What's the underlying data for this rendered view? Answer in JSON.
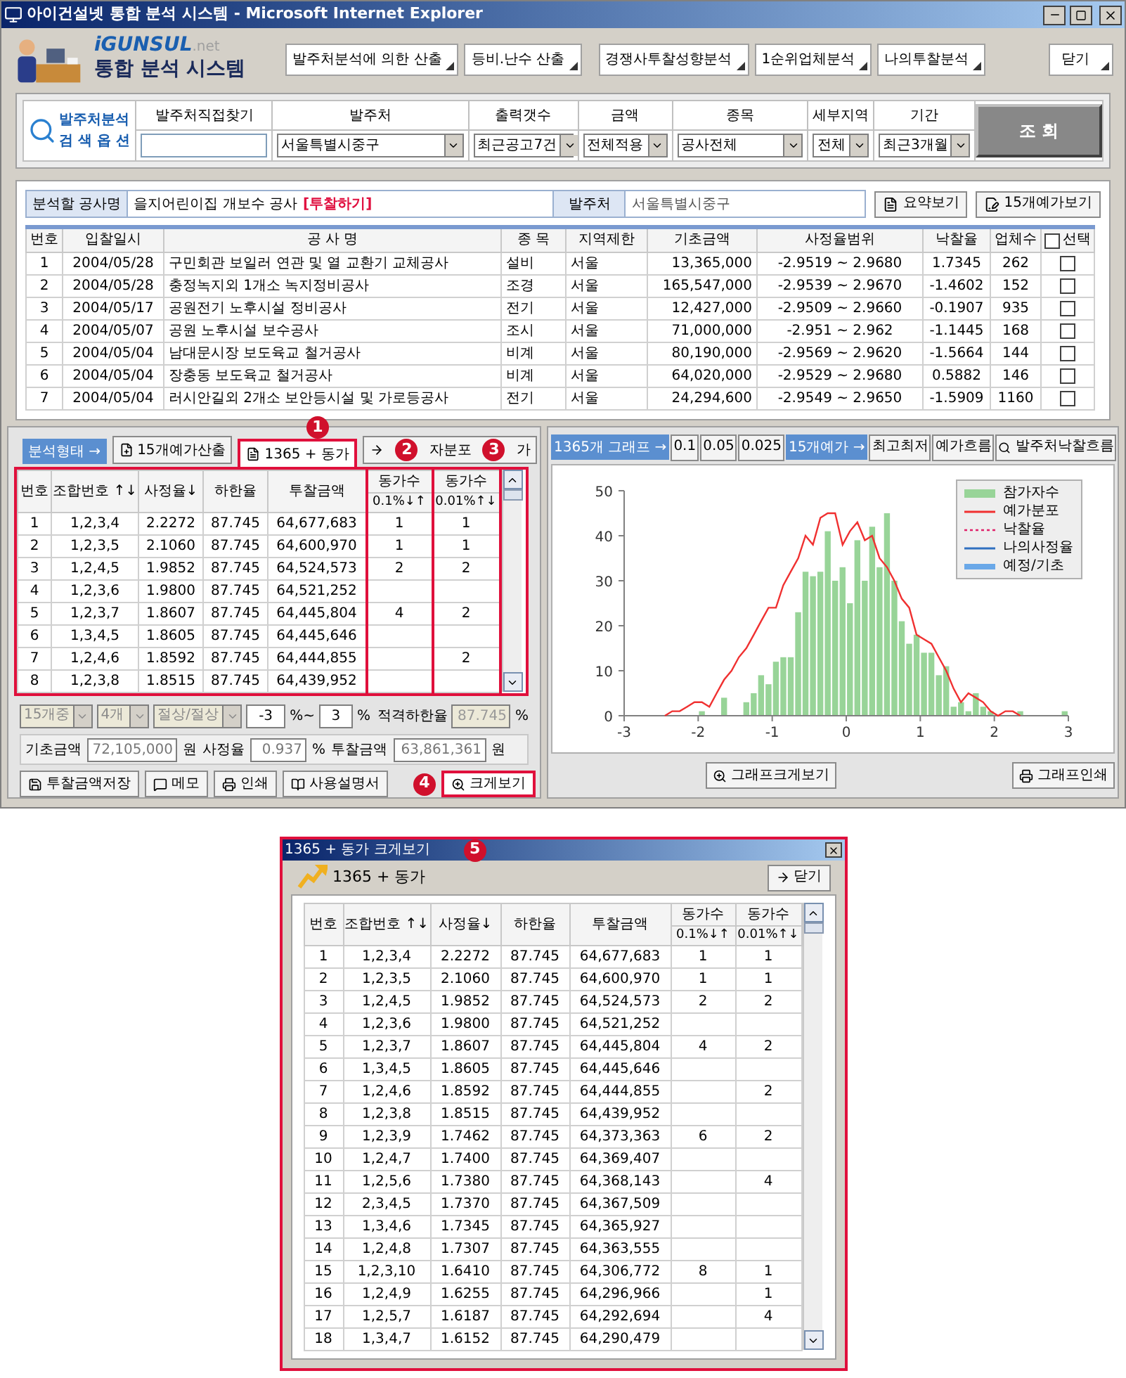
{
  "window": {
    "title": "아이건설넷 통합 분석 시스템 - Microsoft Internet Explorer"
  },
  "header": {
    "brand": "iGUNSUL",
    "brand_suffix": ".net",
    "title": "통합 분석 시스템",
    "nav_buttons": [
      "발주처분석에 의한 산출",
      "등비.난수 산출",
      "경쟁사투찰성향분석",
      "1순위업체분석",
      "나의투찰분석"
    ],
    "close_button": "닫기"
  },
  "search_options": {
    "title": "발주처분석",
    "subtitle": "검 색 옵 션",
    "fields": [
      {
        "label": "발주처직접찾기",
        "kind": "input"
      },
      {
        "label": "발주처",
        "kind": "select",
        "value": "서울특별시중구"
      },
      {
        "label": "출력갯수",
        "kind": "select",
        "value": "최근공고7건"
      },
      {
        "label": "금액",
        "kind": "select",
        "value": "전체적용"
      },
      {
        "label": "종목",
        "kind": "select",
        "value": "공사전체"
      },
      {
        "label": "세부지역",
        "kind": "select",
        "value": "전체"
      },
      {
        "label": "기간",
        "kind": "select",
        "value": "최근3개월"
      }
    ],
    "search_button": "조 회"
  },
  "project": {
    "label": "분석할 공사명",
    "name": "을지어린이집 개보수 공사",
    "link": "[투찰하기]",
    "owner_label": "발주처",
    "owner": "서울특별시중구",
    "buttons": [
      "요약보기",
      "15개예가보기"
    ]
  },
  "bids": {
    "columns": [
      "번호",
      "입찰일시",
      "공 사 명",
      "종 목",
      "지역제한",
      "기초금액",
      "사정율범위",
      "낙찰율",
      "업체수"
    ],
    "select_all": {
      "label": "선택",
      "checked": false
    },
    "rows": [
      {
        "cells": [
          "1",
          "2004/05/28",
          "구민회관 보일러 연관 및 열 교환기 교체공사",
          "설비",
          "서울",
          "13,365,000",
          "-2.9519 ~ 2.9680",
          "1.7345",
          "262"
        ],
        "checked": false
      },
      {
        "cells": [
          "2",
          "2004/05/28",
          "충정녹지외 1개소 녹지정비공사",
          "조경",
          "서울",
          "165,547,000",
          "-2.9539 ~ 2.9670",
          "-1.4602",
          "152"
        ],
        "checked": false
      },
      {
        "cells": [
          "3",
          "2004/05/17",
          "공원전기 노후시설 정비공사",
          "전기",
          "서울",
          "12,427,000",
          "-2.9509 ~ 2.9660",
          "-0.1907",
          "935"
        ],
        "checked": false
      },
      {
        "cells": [
          "4",
          "2004/05/07",
          "공원 노후시설 보수공사",
          "조시",
          "서울",
          "71,000,000",
          "-2.951 ~ 2.962",
          "-1.1445",
          "168"
        ],
        "checked": false
      },
      {
        "cells": [
          "5",
          "2004/05/04",
          "남대문시장 보도육교 철거공사",
          "비계",
          "서울",
          "80,190,000",
          "-2.9569 ~ 2.9620",
          "-1.5664",
          "144"
        ],
        "checked": false
      },
      {
        "cells": [
          "6",
          "2004/05/04",
          "장충동 보도육교 철거공사",
          "비계",
          "서울",
          "64,020,000",
          "-2.9529 ~ 2.9680",
          "0.5882",
          "146"
        ],
        "checked": false
      },
      {
        "cells": [
          "7",
          "2004/05/04",
          "러시안길외 2개소 보안등시설 및 가로등공사",
          "전기",
          "서울",
          "24,294,600",
          "-2.9549 ~ 2.9650",
          "-1.5909",
          "1160"
        ],
        "checked": false
      }
    ]
  },
  "analysis": {
    "label": "분석형태 →",
    "tabs": [
      {
        "parts": [
          "15개예가산출"
        ],
        "selected": false
      },
      {
        "parts": [
          "1365 + 동가"
        ],
        "selected": true
      },
      {
        "parts": [
          "자분포",
          "가"
        ],
        "selected": false
      }
    ],
    "columns": [
      {
        "label": "번호"
      },
      {
        "label": "조합번호 ↑↓"
      },
      {
        "label": "사정율↓"
      },
      {
        "label": "하한율"
      },
      {
        "label": "투찰금액"
      },
      {
        "label": "동가수",
        "sub": "0.1%↓↑"
      },
      {
        "label": "동가수",
        "sub": "0.01%↑↓"
      }
    ],
    "rows": [
      [
        "1",
        "1,2,3,4",
        "2.2272",
        "87.745",
        "64,677,683",
        "1",
        "1"
      ],
      [
        "2",
        "1,2,3,5",
        "2.1060",
        "87.745",
        "64,600,970",
        "1",
        "1"
      ],
      [
        "3",
        "1,2,4,5",
        "1.9852",
        "87.745",
        "64,524,573",
        "2",
        "2"
      ],
      [
        "4",
        "1,2,3,6",
        "1.9800",
        "87.745",
        "64,521,252",
        null,
        null
      ],
      [
        "5",
        "1,2,3,7",
        "1.8607",
        "87.745",
        "64,445,804",
        "4",
        "2"
      ],
      [
        "6",
        "1,3,4,5",
        "1.8605",
        "87.745",
        "64,445,646",
        null,
        null
      ],
      [
        "7",
        "1,2,4,6",
        "1.8592",
        "87.745",
        "64,444,855",
        null,
        "2"
      ],
      [
        "8",
        "1,2,3,8",
        "1.8515",
        "87.745",
        "64,439,952",
        null,
        null
      ]
    ],
    "controls": {
      "selects": [
        {
          "value": "15개중",
          "disabled": true
        },
        {
          "value": "4개",
          "disabled": true
        },
        {
          "value": "절상/절상",
          "disabled": true
        }
      ],
      "range_from": "-3",
      "range_sep": "%~",
      "range_to": "3",
      "range_unit": "%",
      "limit": {
        "label": "적격하한율",
        "value": "87.745",
        "unit": "%",
        "disabled": true
      }
    },
    "amounts": [
      {
        "label": "기초금액",
        "value": "72,105,000",
        "unit": "원"
      },
      {
        "label": "사정율",
        "value": "0.937",
        "unit": "%"
      },
      {
        "label": "투찰금액",
        "value": "63,861,361",
        "unit": "원"
      }
    ],
    "actions": [
      "투찰금액저장",
      "메모",
      "인쇄",
      "사용설명서"
    ],
    "big_view_button": "크게보기"
  },
  "graph": {
    "label": "1365개 그래프 →",
    "steps": [
      "0.1",
      "0.05",
      "0.025"
    ],
    "label2": "15개예가 →",
    "buttons": [
      "최고최저",
      "예가흐름"
    ],
    "flow_button": "발주처낙찰흐름",
    "legend": [
      {
        "label": "낙찰율",
        "kind": "dash",
        "color": "#e0206a"
      },
      {
        "label": "나의사정율",
        "kind": "line",
        "color": "#3070c0"
      },
      {
        "label": "예정/기초",
        "kind": "band",
        "color": "#6aa8e8"
      }
    ],
    "chart_data": {
      "type": "bar",
      "x": [
        -1.95,
        -1.65,
        -1.35,
        -1.25,
        -1.15,
        -1.05,
        -0.95,
        -0.85,
        -0.75,
        -0.65,
        -0.55,
        -0.45,
        -0.35,
        -0.25,
        -0.15,
        -0.05,
        0.05,
        0.15,
        0.25,
        0.35,
        0.45,
        0.55,
        0.65,
        0.75,
        0.85,
        0.95,
        1.05,
        1.15,
        1.25,
        1.35,
        1.45,
        1.55,
        1.65,
        1.75,
        1.85,
        1.95,
        2.35,
        2.95
      ],
      "series": [
        {
          "name": "참가자수",
          "color": "#98d498",
          "values": [
            1,
            4,
            3,
            5,
            9,
            7,
            12,
            13,
            13,
            23,
            32,
            31,
            32,
            41,
            30,
            33,
            25,
            39,
            30,
            42,
            33,
            45,
            30,
            21,
            16,
            18,
            14,
            14,
            9,
            11,
            2,
            3,
            1,
            5,
            2,
            1,
            1,
            1
          ]
        }
      ],
      "xlim": [
        -3,
        3
      ],
      "ylim": [
        0,
        50
      ],
      "xticks": [
        -3,
        -2,
        -1,
        0,
        1,
        2,
        3
      ],
      "yticks": [
        0,
        10,
        20,
        30,
        40,
        50
      ]
    },
    "distribution": {
      "chart_data": {
        "type": "line",
        "x": [
          -2.45,
          -2.35,
          -2.25,
          -2.15,
          -2.05,
          -1.95,
          -1.85,
          -1.75,
          -1.65,
          -1.55,
          -1.45,
          -1.35,
          -1.25,
          -1.15,
          -1.05,
          -0.95,
          -0.85,
          -0.75,
          -0.65,
          -0.55,
          -0.45,
          -0.35,
          -0.25,
          -0.15,
          -0.05,
          0.05,
          0.15,
          0.25,
          0.35,
          0.45,
          0.55,
          0.65,
          0.75,
          0.85,
          0.95,
          1.05,
          1.15,
          1.25,
          1.35,
          1.45,
          1.55,
          1.65,
          1.75,
          1.85,
          1.95,
          2.05,
          2.15,
          2.25,
          2.35
        ],
        "series": [
          {
            "name": "예가분포",
            "color": "#f03030",
            "values": [
              0,
              1,
              1,
              2,
              3,
              3,
              2,
              5,
              8,
              10,
              13,
              15,
              18,
              21,
              24,
              24,
              29,
              32,
              35,
              40,
              38,
              44,
              45,
              45,
              38,
              41,
              43,
              39,
              40,
              35,
              33,
              30,
              26,
              24,
              18,
              17,
              16,
              13,
              10,
              6,
              3,
              5,
              4,
              3,
              1,
              0,
              1,
              1,
              0
            ]
          }
        ],
        "xlim": [
          -3,
          3
        ],
        "ylim": [
          0,
          50
        ]
      }
    },
    "footer_buttons": [
      "그래프크게보기",
      "그래프인쇄"
    ]
  },
  "popup": {
    "title": "1365 + 동가 크게보기",
    "heading": "1365 + 동가",
    "close": "닫기",
    "columns": [
      {
        "label": "번호"
      },
      {
        "label": "조합번호 ↑↓"
      },
      {
        "label": "사정율↓"
      },
      {
        "label": "하한율"
      },
      {
        "label": "투찰금액"
      },
      {
        "label": "동가수",
        "sub": "0.1%↓↑"
      },
      {
        "label": "동가수",
        "sub": "0.01%↑↓"
      }
    ],
    "rows": [
      [
        "1",
        "1,2,3,4",
        "2.2272",
        "87.745",
        "64,677,683",
        "1",
        "1"
      ],
      [
        "2",
        "1,2,3,5",
        "2.1060",
        "87.745",
        "64,600,970",
        "1",
        "1"
      ],
      [
        "3",
        "1,2,4,5",
        "1.9852",
        "87.745",
        "64,524,573",
        "2",
        "2"
      ],
      [
        "4",
        "1,2,3,6",
        "1.9800",
        "87.745",
        "64,521,252",
        null,
        null
      ],
      [
        "5",
        "1,2,3,7",
        "1.8607",
        "87.745",
        "64,445,804",
        "4",
        "2"
      ],
      [
        "6",
        "1,3,4,5",
        "1.8605",
        "87.745",
        "64,445,646",
        null,
        null
      ],
      [
        "7",
        "1,2,4,6",
        "1.8592",
        "87.745",
        "64,444,855",
        null,
        "2"
      ],
      [
        "8",
        "1,2,3,8",
        "1.8515",
        "87.745",
        "64,439,952",
        null,
        null
      ],
      [
        "9",
        "1,2,3,9",
        "1.7462",
        "87.745",
        "64,373,363",
        "6",
        "2"
      ],
      [
        "10",
        "1,2,4,7",
        "1.7400",
        "87.745",
        "64,369,407",
        null,
        null
      ],
      [
        "11",
        "1,2,5,6",
        "1.7380",
        "87.745",
        "64,368,143",
        null,
        "4"
      ],
      [
        "12",
        "2,3,4,5",
        "1.7370",
        "87.745",
        "64,367,509",
        null,
        null
      ],
      [
        "13",
        "1,3,4,6",
        "1.7345",
        "87.745",
        "64,365,927",
        null,
        null
      ],
      [
        "14",
        "1,2,4,8",
        "1.7307",
        "87.745",
        "64,363,555",
        null,
        null
      ],
      [
        "15",
        "1,2,3,10",
        "1.6410",
        "87.745",
        "64,306,772",
        "8",
        "1"
      ],
      [
        "16",
        "1,2,4,9",
        "1.6255",
        "87.745",
        "64,296,966",
        null,
        "1"
      ],
      [
        "17",
        "1,2,5,7",
        "1.6187",
        "87.745",
        "64,292,694",
        null,
        "4"
      ],
      [
        "18",
        "1,3,4,7",
        "1.6152",
        "87.745",
        "64,290,479",
        null,
        null
      ]
    ]
  },
  "callouts": [
    "1",
    "2",
    "3",
    "4",
    "5"
  ]
}
